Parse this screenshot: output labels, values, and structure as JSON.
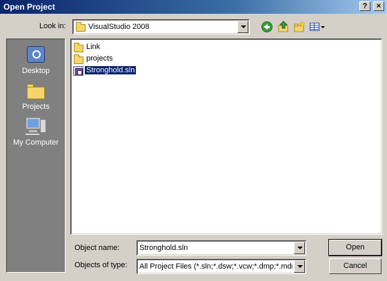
{
  "window": {
    "title": "Open Project",
    "help_glyph": "?",
    "close_glyph": "×"
  },
  "toolbar": {
    "look_in_label": "Look in:",
    "look_in_value": "VisualStudio 2008",
    "icons": [
      "back-icon",
      "up-folder-icon",
      "new-folder-icon",
      "views-menu-icon"
    ]
  },
  "places": [
    {
      "label": "Desktop",
      "icon": "desktop-icon"
    },
    {
      "label": "Projects",
      "icon": "folder-icon"
    },
    {
      "label": "My Computer",
      "icon": "computer-icon"
    }
  ],
  "files": [
    {
      "name": "Link",
      "type": "folder"
    },
    {
      "name": "projects",
      "type": "folder"
    },
    {
      "name": "Stronghold.sln",
      "type": "solution",
      "selected": true
    }
  ],
  "form": {
    "object_name_label": "Object name:",
    "object_name_value": "Stronghold.sln",
    "object_type_label": "Objects of type:",
    "object_type_value": "All Project Files (*.sln;*.dsw;*.vcw;*.dmp;*.mdmp"
  },
  "buttons": {
    "open": "Open",
    "cancel": "Cancel"
  },
  "colors": {
    "title_bar": "#0a246a",
    "dialog_face": "#d4d0c8",
    "places_bar": "#808080",
    "selection": "#0a246a"
  }
}
